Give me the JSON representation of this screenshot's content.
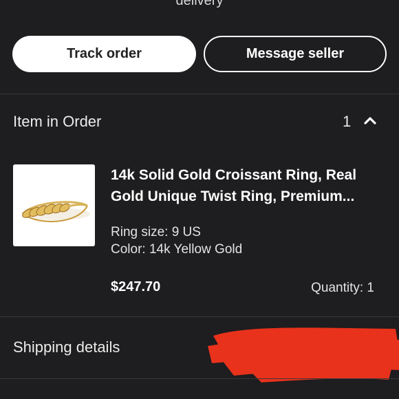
{
  "top_partial_text": "delivery",
  "actions": {
    "track_order": "Track order",
    "message_seller": "Message seller"
  },
  "items_section": {
    "title": "Item in Order",
    "count": "1",
    "expanded_icon": "chevron-up-icon"
  },
  "item": {
    "title_line1": "14k Solid Gold Croissant Ring, Real",
    "title_line2": "Gold Unique Twist Ring, Premium...",
    "ring_size": "Ring size: 9 US",
    "color": "Color: 14k Yellow Gold",
    "price": "$247.70",
    "quantity": "Quantity: 1",
    "image_icon": "gold-twist-ring-image"
  },
  "shipping": {
    "title": "Shipping details",
    "redaction_color": "#e8321c"
  },
  "colors": {
    "background": "#1e1d1f",
    "primary_button_bg": "#ffffff",
    "primary_button_text": "#222222",
    "divider": "#38373a"
  }
}
